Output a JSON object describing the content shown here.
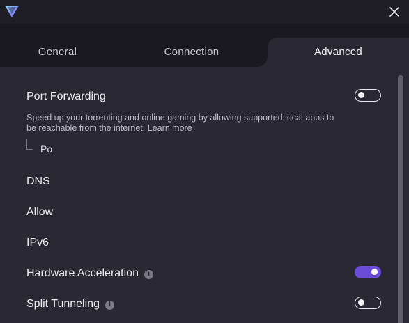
{
  "window": {
    "close_icon": "close-icon",
    "logo_icon": "vpn-logo-icon"
  },
  "tabs": [
    {
      "label": "General"
    },
    {
      "label": "Connection"
    },
    {
      "label": "Advanced",
      "active": true
    }
  ],
  "settings": {
    "port_forwarding": {
      "title": "Port Forwarding",
      "description": "Speed up your torrenting and online gaming by allowing supported local apps to be reachable from the internet. Learn more",
      "toggle_on": false,
      "sub_label": "Po"
    },
    "dns": {
      "title": "DNS"
    },
    "allow": {
      "title": "Allow"
    },
    "ipv6": {
      "title": "IPv6"
    },
    "hardware_acceleration": {
      "title": "Hardware Acceleration",
      "toggle_on": true
    },
    "split_tunneling": {
      "title": "Split Tunneling",
      "toggle_on": false
    }
  },
  "colors": {
    "background": "#2a2833",
    "titlebar": "#1f1d26",
    "tabbar": "#1a1820",
    "accent": "#6a4cd8"
  }
}
